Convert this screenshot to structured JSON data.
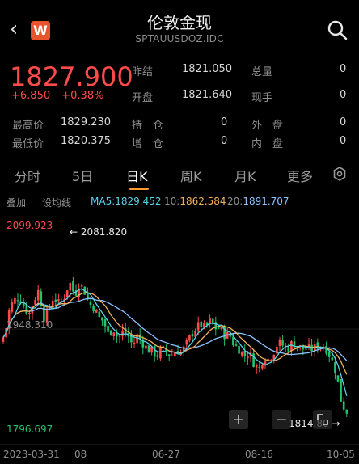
{
  "header": {
    "title": "伦敦金现",
    "subtitle": "SPTAUUSDOZ.IDC",
    "logo_text": "W",
    "back_icon": "chevron-left-icon",
    "search_icon": "search-icon"
  },
  "quote": {
    "price": "1827.900",
    "change": "+6.850",
    "change_pct": "+0.38%",
    "prev_close_label": "昨结",
    "prev_close": "1821.050",
    "open_label": "开盘",
    "open": "1821.640",
    "volume_label": "总量",
    "volume": "0",
    "current_hand_label": "现手",
    "current_hand": "0",
    "high_label": "最高价",
    "high": "1829.230",
    "low_label": "最低价",
    "low": "1820.375",
    "hold_label": "持　仓",
    "hold": "0",
    "add_label": "增　仓",
    "add": "0",
    "outer_label": "外　盘",
    "outer": "0",
    "inner_label": "内　盘",
    "inner": "0"
  },
  "tabs": [
    "分时",
    "5日",
    "日K",
    "周K",
    "月K",
    "更多"
  ],
  "active_tab": "日K",
  "indicators": {
    "adjust": "叠加",
    "trend": "设均线",
    "ma5_label": "MA5:",
    "ma5": "1829.452",
    "ma10_label": "10:",
    "ma10": "1862.584",
    "ma20_label": "20:",
    "ma20": "1891.707"
  },
  "chart_data": {
    "type": "candlestick",
    "ylim": [
      1796.697,
      2099.923
    ],
    "y_top_label": "2099.923",
    "y_mid_label": "1948.310",
    "y_bottom_label": "1796.697",
    "max_annotation": "2081.820",
    "min_annotation": "1814.80",
    "x_labels": [
      "2023-03-31",
      "08",
      "06-27",
      "08-16",
      "10-05"
    ],
    "up_color": "#ff4a4a",
    "down_color": "#22c36b",
    "ma5_color": "#5ad0e6",
    "ma10_color": "#f2b15b",
    "ma20_color": "#8bc2ff"
  },
  "chart_controls": {
    "zoom_in": "+",
    "zoom_out": "−"
  }
}
